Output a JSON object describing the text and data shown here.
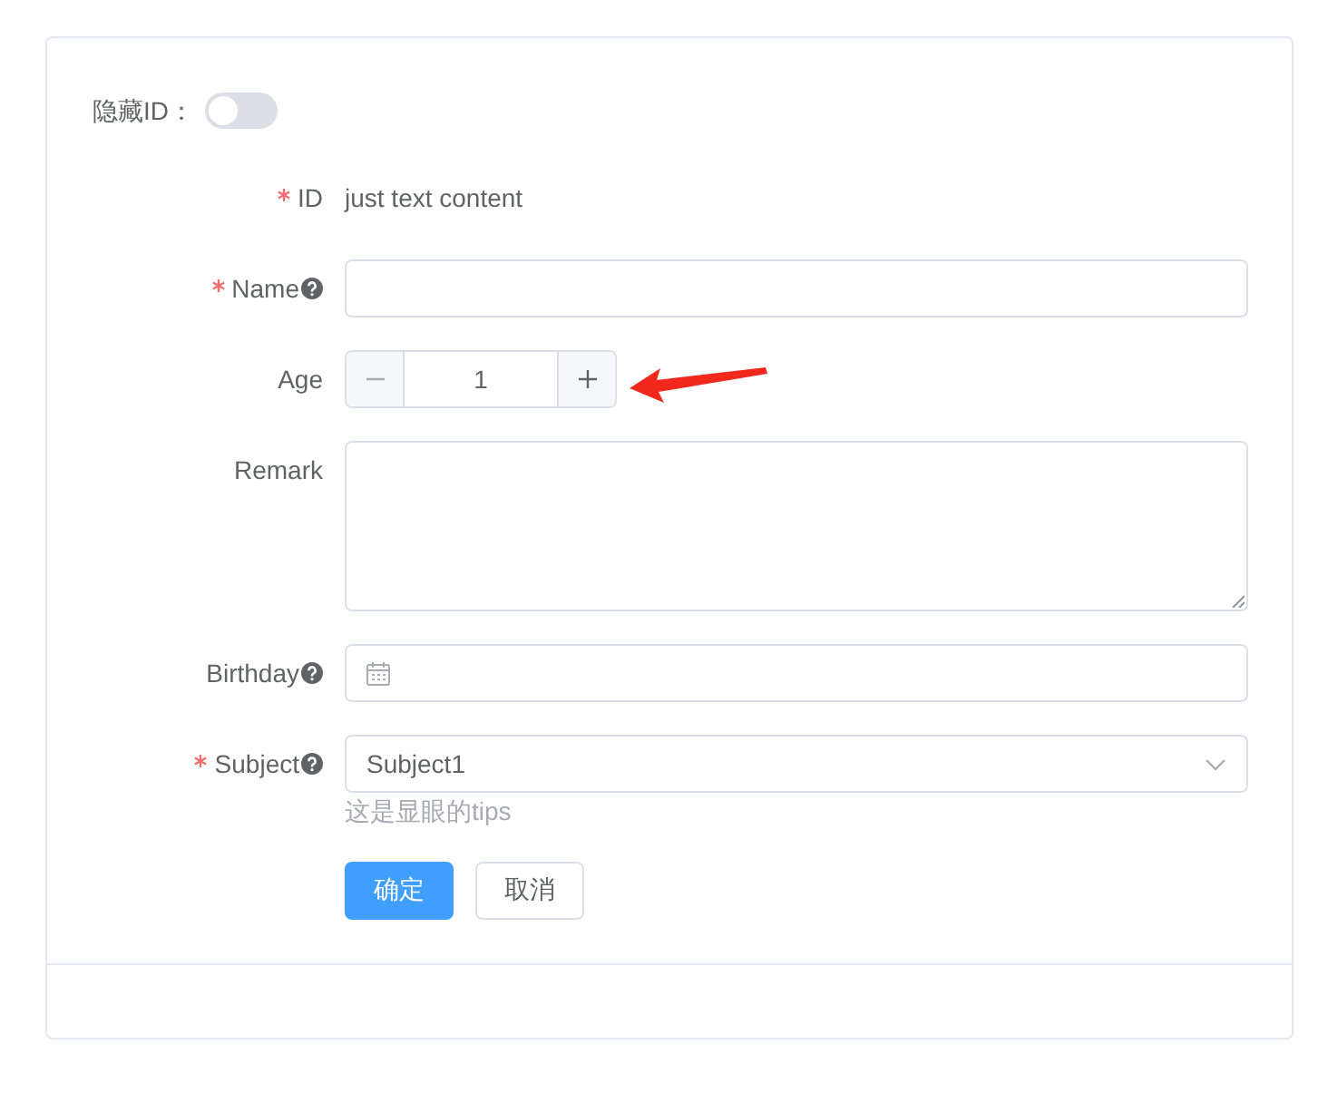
{
  "toggle": {
    "label": "隐藏ID：",
    "on": false
  },
  "fields": [
    {
      "kind": "text",
      "label": "ID",
      "required": true,
      "help": false,
      "value": "just text content",
      "annotated": false
    },
    {
      "kind": "input",
      "label": "Name",
      "required": true,
      "help": true,
      "annotated": false
    },
    {
      "kind": "number",
      "label": "Age",
      "required": false,
      "help": false,
      "value": "1",
      "annotated": true
    },
    {
      "kind": "textarea",
      "label": "Remark",
      "required": false,
      "help": false,
      "annotated": false
    },
    {
      "kind": "date",
      "label": "Birthday",
      "required": false,
      "help": true,
      "annotated": false
    },
    {
      "kind": "select",
      "label": "Subject",
      "required": true,
      "help": true,
      "value": "Subject1",
      "tip": "这是显眼的tips",
      "annotated": false
    }
  ],
  "buttons": [
    {
      "label": "确定",
      "kind": "primary"
    },
    {
      "label": "取消",
      "kind": "default"
    }
  ]
}
